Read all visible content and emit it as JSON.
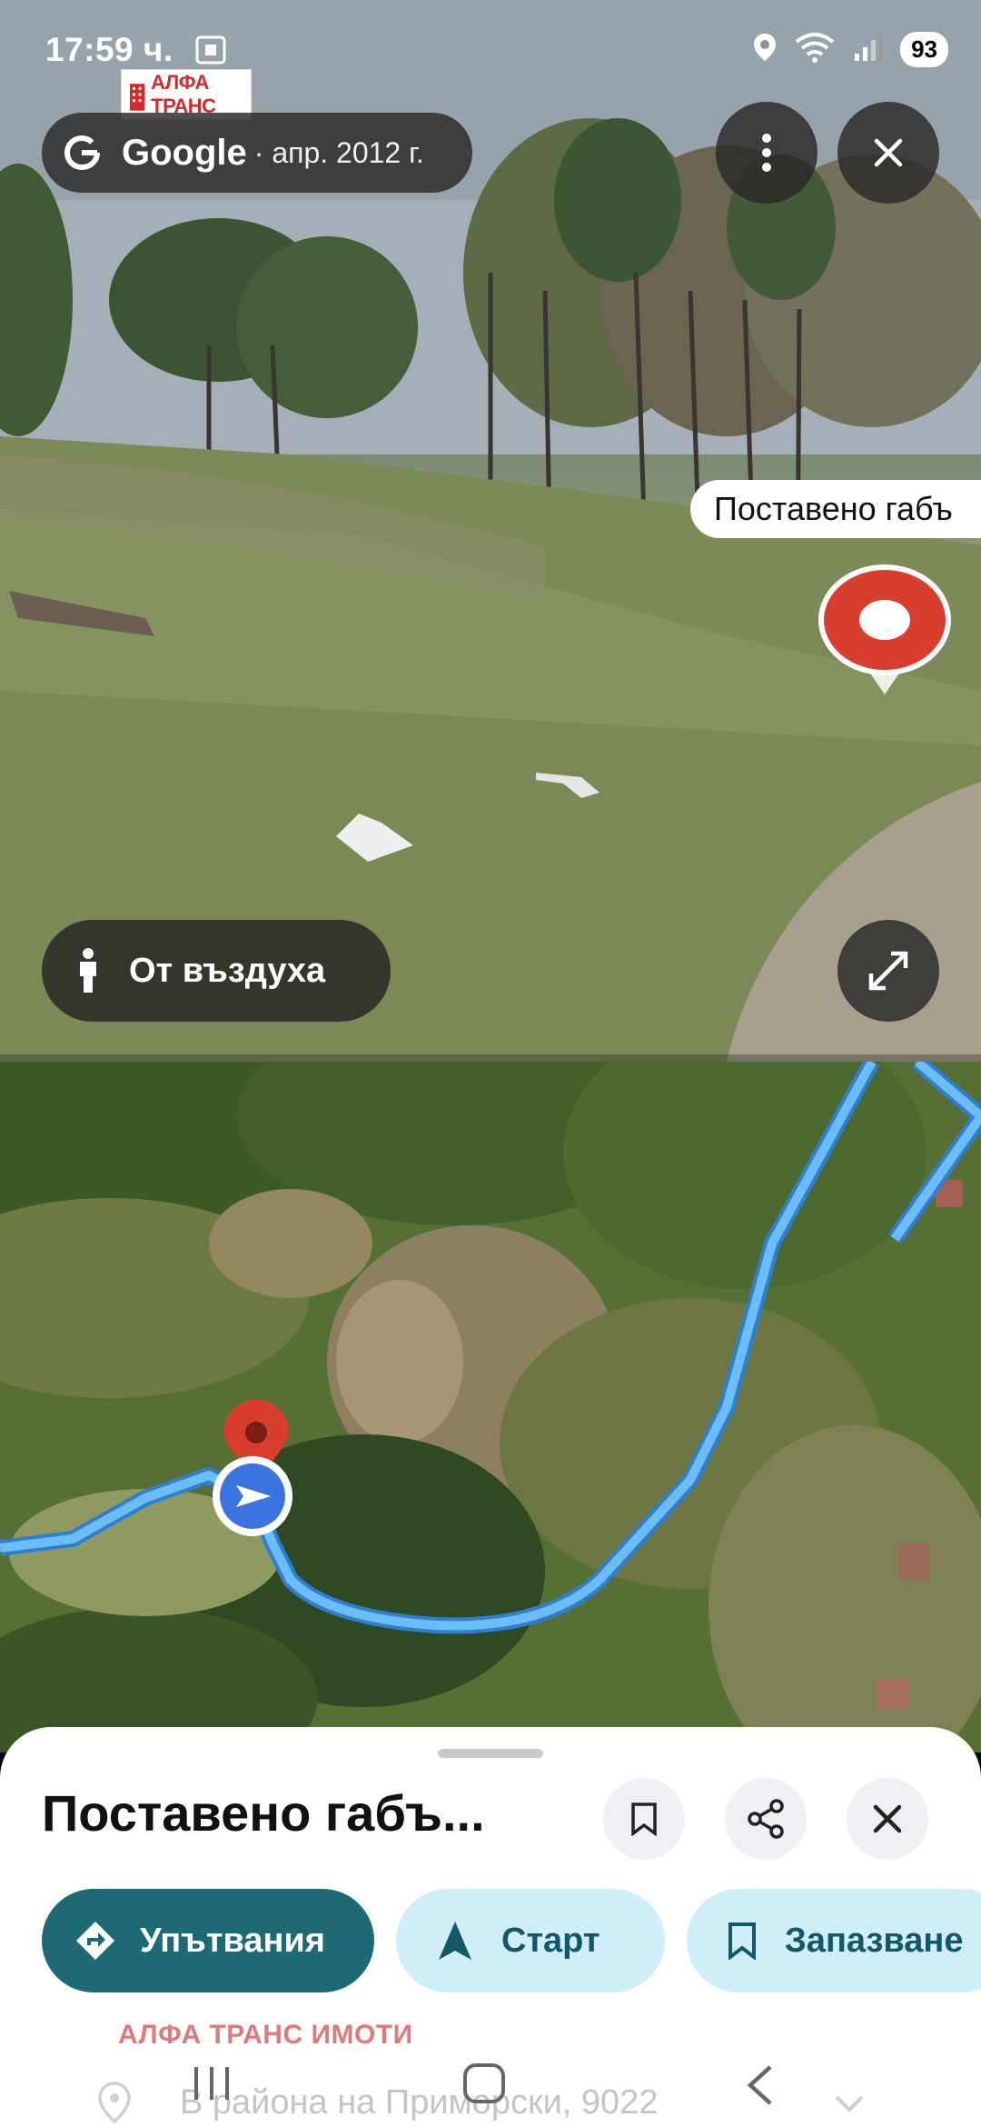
{
  "status_bar": {
    "time": "17:59 ч.",
    "battery": "93",
    "icons": [
      "screenshot-icon",
      "location-icon",
      "wifi-icon",
      "signal-icon"
    ]
  },
  "watermark_logo": {
    "text": "АЛФА ТРАНС"
  },
  "street_view": {
    "brand": "Google",
    "date": "· апр. 2012 г.",
    "place_label": "Поставено габъ",
    "aerial_button": "От въздуха",
    "buttons": [
      "more-options",
      "close",
      "expand"
    ]
  },
  "map": {
    "route_color": "#4aa3f0",
    "pin_color": "#d93d2e",
    "location_color": "#3b74e0"
  },
  "place_sheet": {
    "title": "Поставено габъ...",
    "actions": {
      "directions": "Упътвания",
      "start": "Старт",
      "save": "Запазване"
    },
    "watermark": "АЛФА ТРАНС ИМОТИ",
    "address": "В района на Приморски, 9022"
  },
  "colors": {
    "directions_chip": "#1e6a74",
    "secondary_chip": "#cfeef8",
    "secondary_text": "#14566a"
  }
}
